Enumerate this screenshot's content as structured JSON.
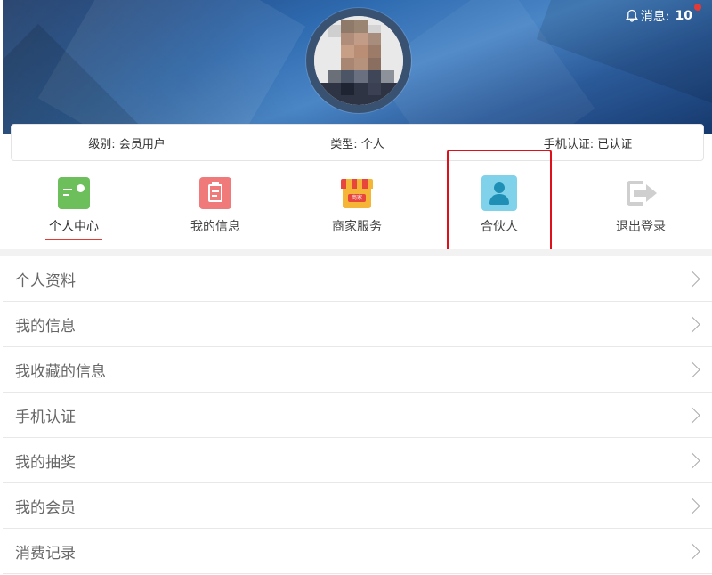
{
  "header": {
    "messages_label": "消息:",
    "messages_count": "10",
    "bell_icon": "bell-icon"
  },
  "info_bar": [
    {
      "label": "级别:",
      "value": "会员用户"
    },
    {
      "label": "类型:",
      "value": "个人"
    },
    {
      "label": "手机认证:",
      "value": "已认证"
    }
  ],
  "nav": [
    {
      "label": "个人中心",
      "icon": "id-card-icon",
      "color": "#6cbf5a",
      "active": true
    },
    {
      "label": "我的信息",
      "icon": "clipboard-icon",
      "color": "#f07a7a",
      "active": false
    },
    {
      "label": "商家服务",
      "icon": "storefront-icon",
      "color": "#f5b638",
      "active": false
    },
    {
      "label": "合伙人",
      "icon": "person-icon",
      "color": "#7fd2ea",
      "active": false,
      "highlighted": true
    },
    {
      "label": "退出登录",
      "icon": "logout-icon",
      "color": "#cfcfcf",
      "active": false
    }
  ],
  "store_badge": "商家",
  "menu": [
    {
      "label": "个人资料"
    },
    {
      "label": "我的信息"
    },
    {
      "label": "我收藏的信息"
    },
    {
      "label": "手机认证"
    },
    {
      "label": "我的抽奖"
    },
    {
      "label": "我的会员"
    },
    {
      "label": "消费记录"
    }
  ],
  "colors": {
    "accent_red": "#e53935",
    "banner_blue": "#2f6bb0",
    "highlight_border": "#e0101a"
  }
}
